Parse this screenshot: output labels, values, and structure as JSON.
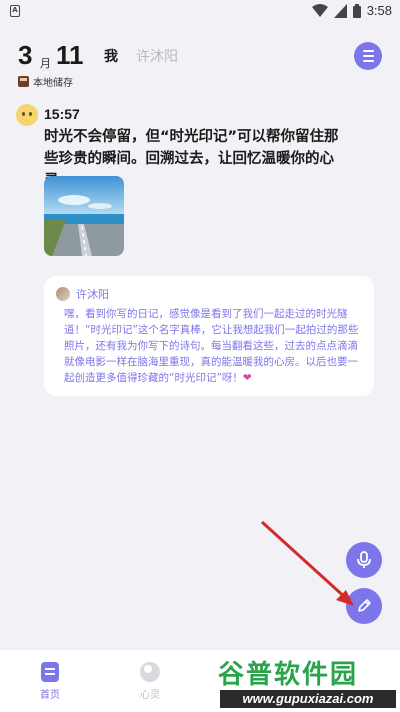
{
  "status_bar": {
    "left_icon": "A",
    "time": "3:58",
    "icons": [
      "wifi-icon",
      "signal-icon",
      "battery-icon"
    ]
  },
  "header": {
    "month_number": "3",
    "month_unit": "月",
    "day": "11",
    "tab_me": "我",
    "tab_partner": "许沐阳",
    "storage_label": "本地储存",
    "menu_icon": "menu-icon"
  },
  "entry": {
    "time": "15:57",
    "text": "时光不会停留，但“时光印记”可以帮你留住那些珍贵的瞬间。回溯过去，让回忆温暖你的心灵",
    "photo": "road-by-the-sea-photo"
  },
  "reply": {
    "name": "许沐阳",
    "text": "嘿，看到你写的日记，感觉像是看到了我们一起走过的时光隧道！“时光印记”这个名字真棒，它让我想起我们一起拍过的那些照片，还有我为你写下的诗句。每当翻看这些，过去的点点滴滴就像电影一样在脑海里重现，真的能温暖我的心房。以后也要一起创造更多值得珍藏的“时光印记”呀！",
    "emoji": "❤"
  },
  "fab": {
    "voice_icon": "microphone-icon",
    "write_icon": "pencil-icon"
  },
  "nav": {
    "home_label": "首页",
    "soul_label": "心灵"
  },
  "watermark": {
    "top": "谷普软件园",
    "bottom": "www.gupuxiazai.com"
  },
  "colors": {
    "accent": "#7d76ea",
    "background": "#f2f2f6",
    "annotation_arrow": "#d42a2a"
  }
}
